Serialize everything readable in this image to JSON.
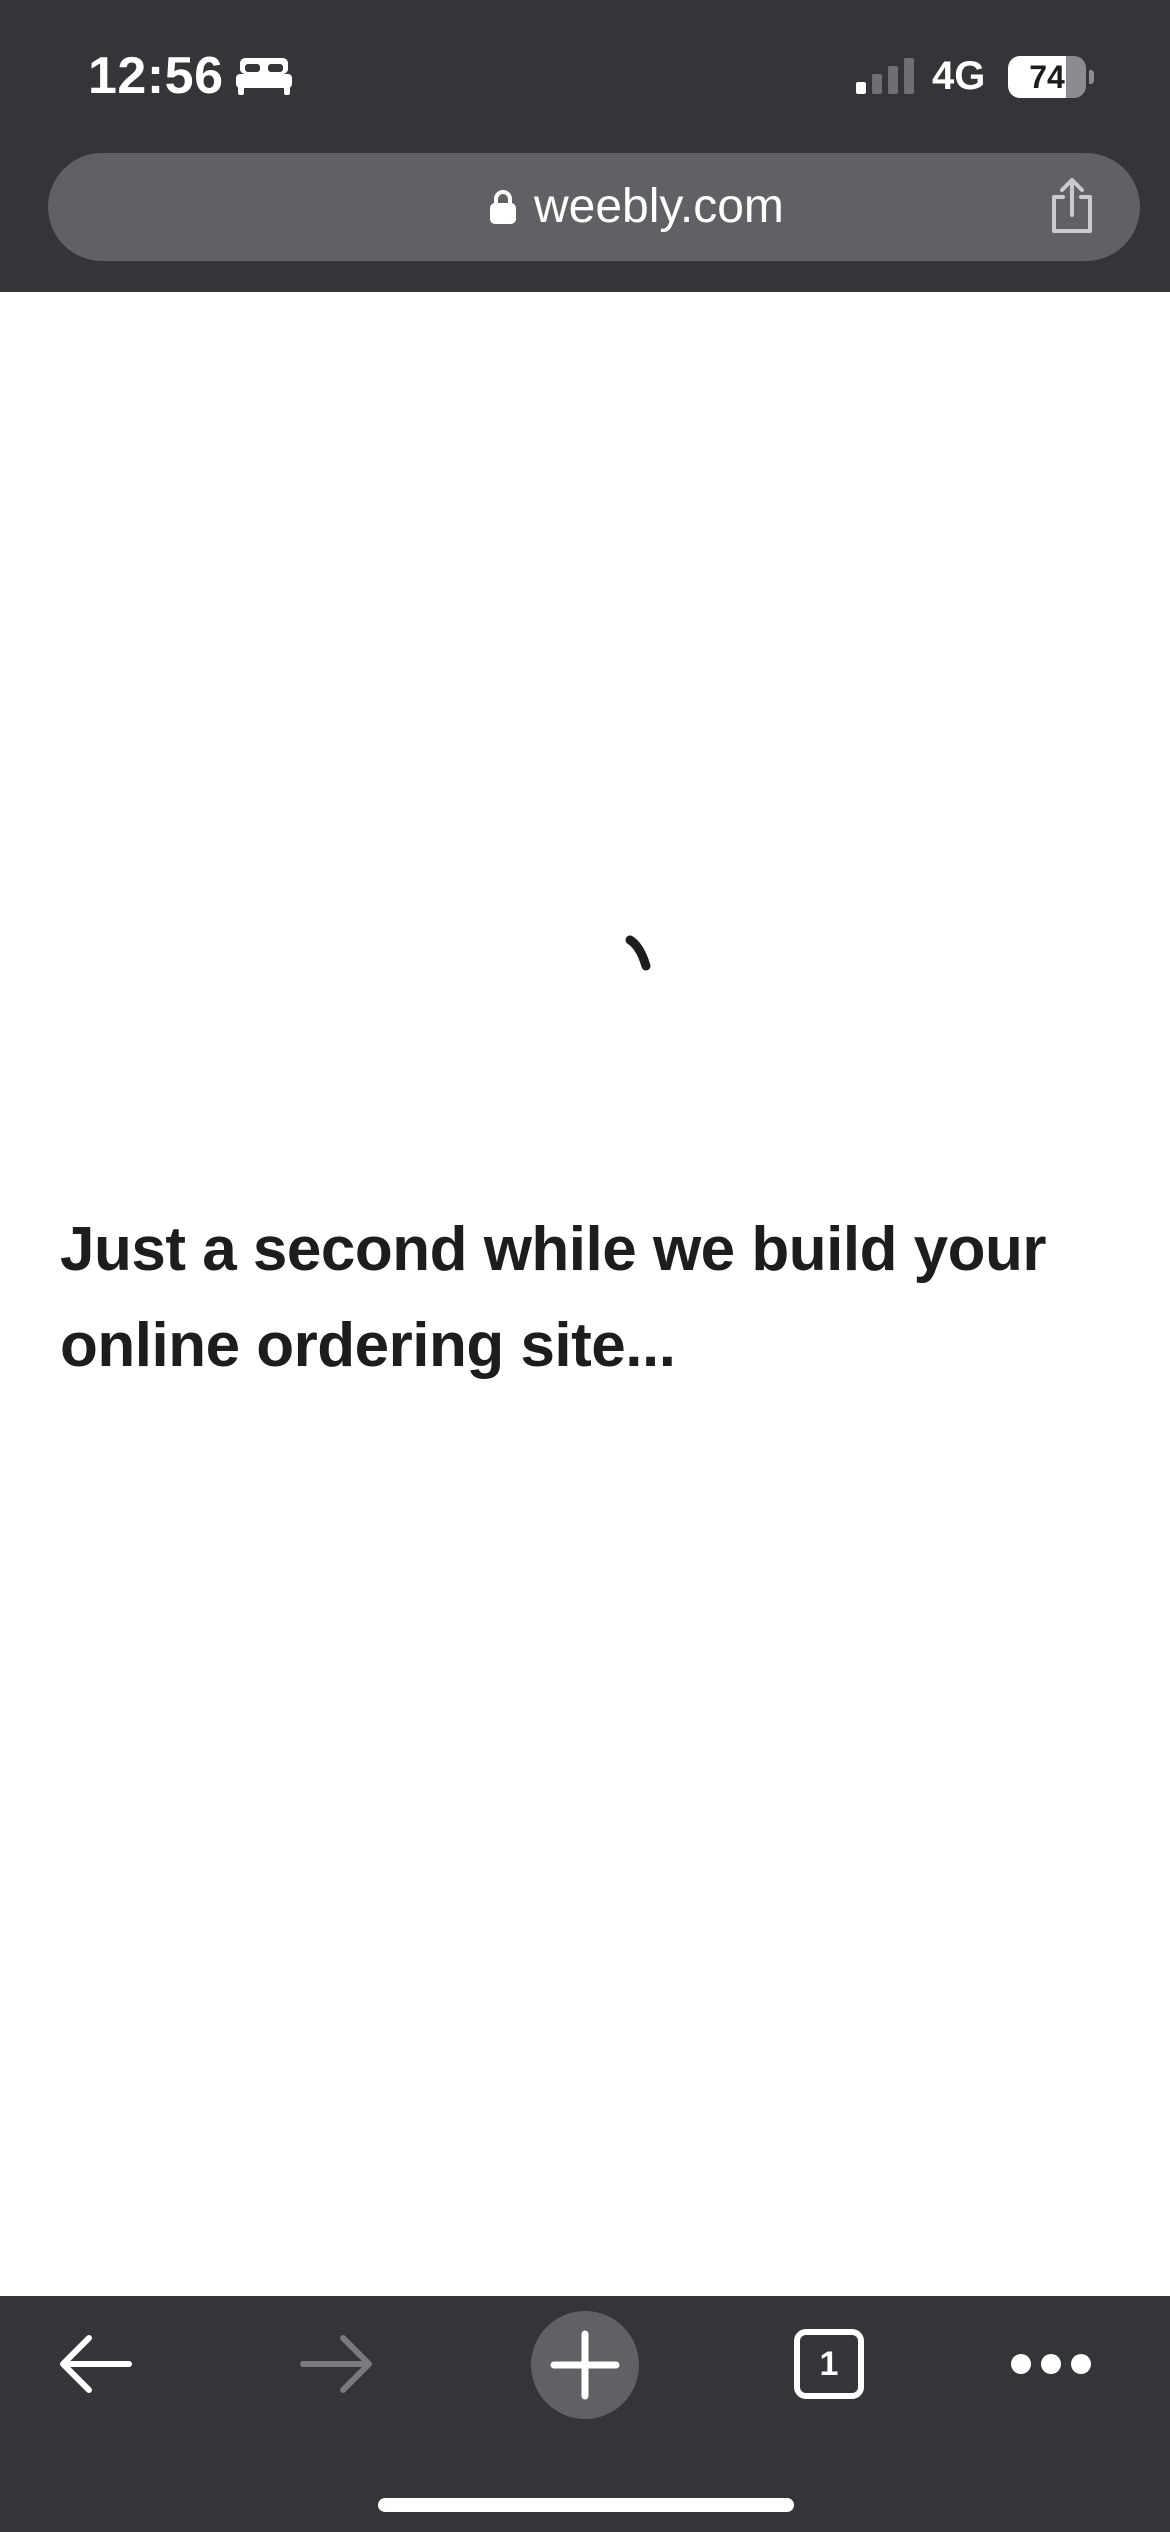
{
  "status_bar": {
    "time": "12:56",
    "network": "4G",
    "battery_level": "74",
    "battery_fraction": 0.74,
    "signal_bars_active": 1,
    "signal_bars_total": 4,
    "icons": [
      "bed-icon",
      "signal-icon",
      "battery-icon"
    ]
  },
  "browser": {
    "url": "weebly.com",
    "tab_count": "1",
    "icons": [
      "lock-icon",
      "share-icon",
      "back-arrow-icon",
      "forward-arrow-icon",
      "plus-icon",
      "tabs-icon",
      "more-icon"
    ]
  },
  "page": {
    "headline": "Just a second while we build your online ordering site..."
  },
  "colors": {
    "chrome_bg": "#343538",
    "url_bar_bg": "#5f6165",
    "page_bg": "#ffffff",
    "headline_text": "#1d1d1f",
    "disabled_icon": "#7a7b7e"
  }
}
